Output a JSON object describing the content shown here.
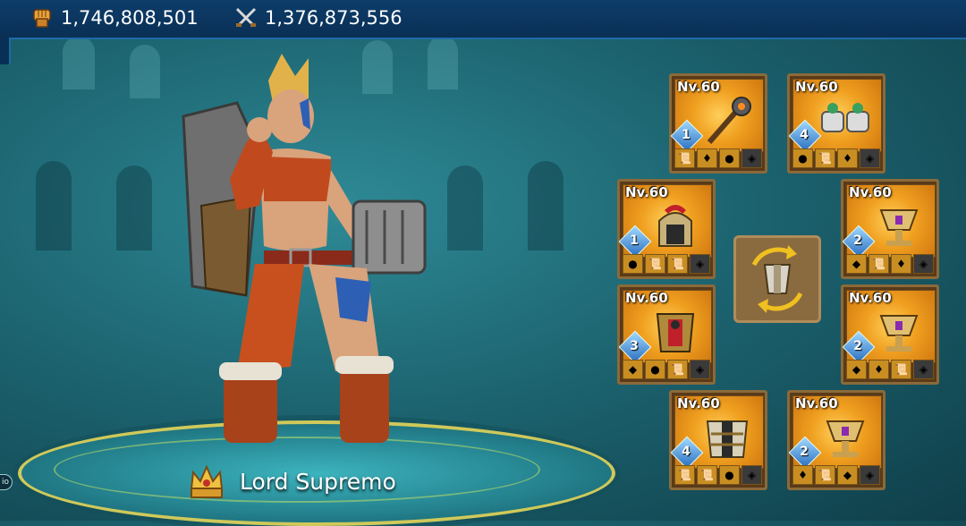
{
  "resources": {
    "might": {
      "icon": "fist-icon",
      "value": "1,746,808,501"
    },
    "kills": {
      "icon": "crossed-swords-icon",
      "value": "1,376,873,556"
    }
  },
  "hero": {
    "title": "Lord Supremo",
    "badge_icon": "crown-icon"
  },
  "side_tab": {
    "label": "io"
  },
  "equipment": {
    "slots": [
      {
        "level": "Nv.60",
        "refine": "1",
        "item": "mace"
      },
      {
        "level": "Nv.60",
        "refine": "4",
        "item": "gauntlets"
      },
      {
        "level": "Nv.60",
        "refine": "1",
        "item": "helmet"
      },
      {
        "level": "Nv.60",
        "refine": "2",
        "item": "chalice"
      },
      {
        "level": "Nv.60",
        "refine": "3",
        "item": "armor"
      },
      {
        "level": "Nv.60",
        "refine": "2",
        "item": "chalice"
      },
      {
        "level": "Nv.60",
        "refine": "4",
        "item": "chest-plate"
      },
      {
        "level": "Nv.60",
        "refine": "2",
        "item": "chalice"
      }
    ],
    "swap_button": {
      "icon": "armor-swap-icon"
    }
  },
  "colors": {
    "accent": "#f0a020",
    "panel": "#5a3a18",
    "topbar": "#0a2f55"
  }
}
